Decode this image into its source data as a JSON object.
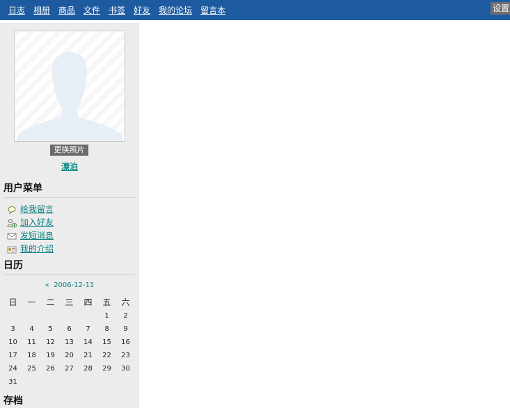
{
  "topnav": {
    "items": [
      {
        "label": "日志"
      },
      {
        "label": "相册"
      },
      {
        "label": "商品"
      },
      {
        "label": "文件"
      },
      {
        "label": "书签"
      },
      {
        "label": "好友"
      },
      {
        "label": "我的论坛"
      },
      {
        "label": "留言本"
      }
    ],
    "settings_label": "设置"
  },
  "profile": {
    "change_photo_label": "更换照片",
    "nickname": "漂泊"
  },
  "user_menu": {
    "title": "用户菜单",
    "items": [
      {
        "label": "给我留言",
        "icon": "comment-icon"
      },
      {
        "label": "加入好友",
        "icon": "add-friend-icon"
      },
      {
        "label": "发短消息",
        "icon": "envelope-icon"
      },
      {
        "label": "我的介绍",
        "icon": "id-card-icon"
      }
    ]
  },
  "calendar": {
    "title": "日历",
    "prev_label": "«",
    "current_date": "2006-12-11",
    "weekdays": [
      "日",
      "一",
      "二",
      "三",
      "四",
      "五",
      "六"
    ],
    "days": [
      "",
      "",
      "",
      "",
      "",
      "1",
      "2",
      "3",
      "4",
      "5",
      "6",
      "7",
      "8",
      "9",
      "10",
      "11",
      "12",
      "13",
      "14",
      "15",
      "16",
      "17",
      "18",
      "19",
      "20",
      "21",
      "22",
      "23",
      "24",
      "25",
      "26",
      "27",
      "28",
      "29",
      "30",
      "31"
    ]
  },
  "archive": {
    "title": "存档"
  },
  "colors": {
    "topbar": "#1e5aa0",
    "link": "#0a8080",
    "sidebar_bg": "#ececec"
  }
}
